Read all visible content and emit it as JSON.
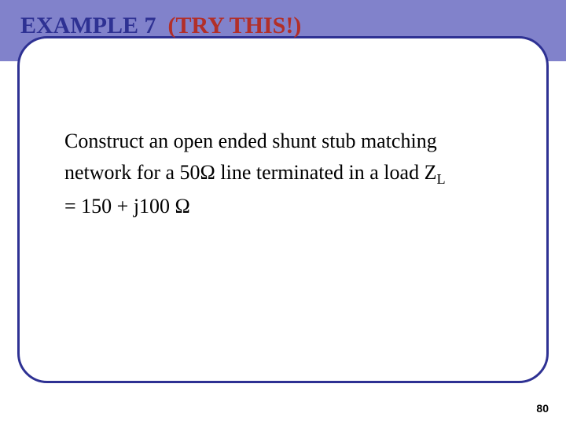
{
  "title": {
    "prefix": "EXAMPLE 7",
    "suffix": "(TRY THIS!)"
  },
  "body": {
    "line1": "Construct an open ended shunt stub matching",
    "line2_pre": "network for a 50Ω line terminated in a load Z",
    "line2_sub": "L",
    "line3": "= 150 + j100 Ω"
  },
  "page_number": "80"
}
